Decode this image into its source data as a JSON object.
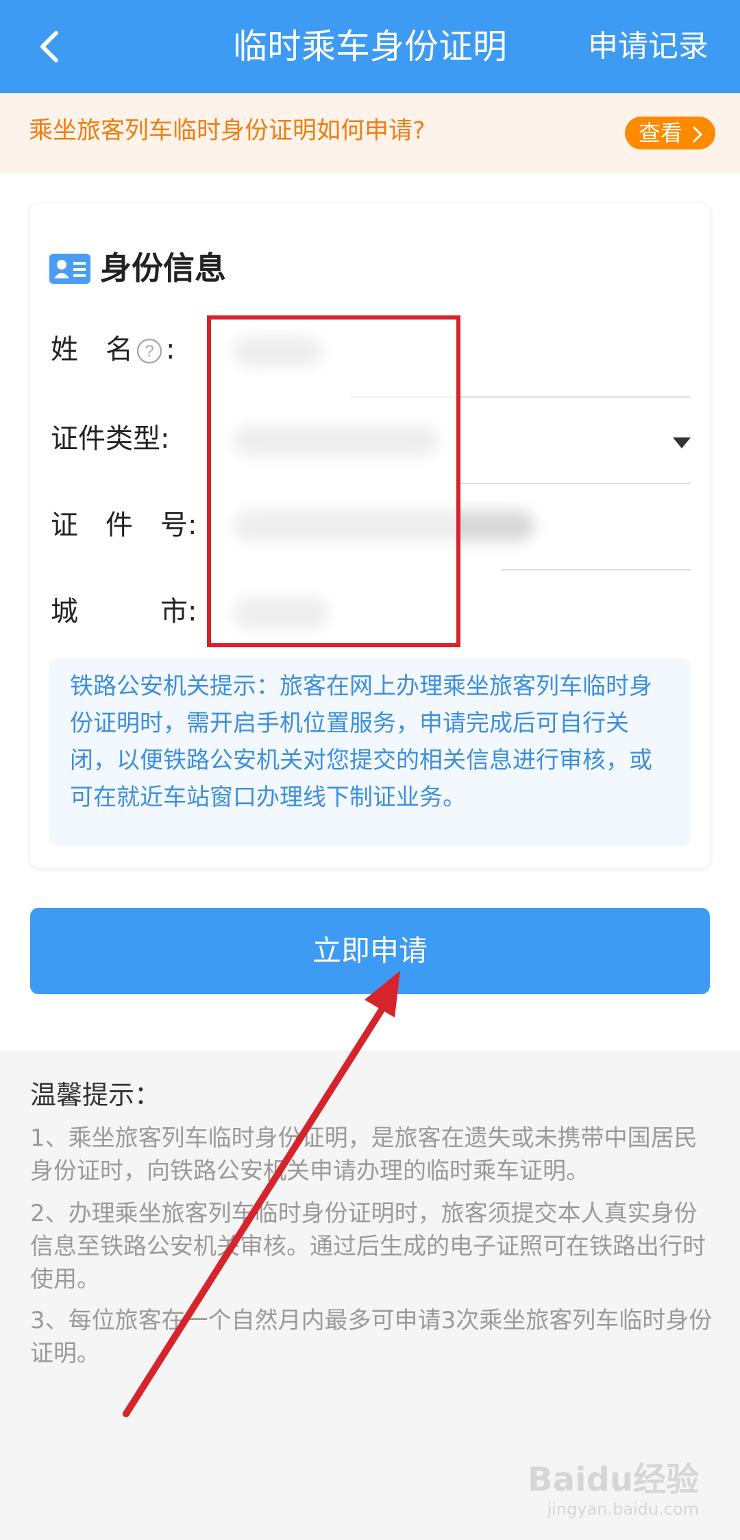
{
  "header": {
    "title": "临时乘车身份证明",
    "record_label": "申请记录"
  },
  "banner": {
    "text": "乘坐旅客列车临时身份证明如何申请?",
    "button": "查看"
  },
  "card": {
    "title": "身份信息",
    "fields": [
      {
        "label": "姓　名",
        "suffix": ":"
      },
      {
        "label": "证件类型:"
      },
      {
        "label": "证　件　号:"
      },
      {
        "label": "城　　　市:"
      }
    ],
    "notice": "铁路公安机关提示：旅客在网上办理乘坐旅客列车临时身份证明时，需开启手机位置服务，申请完成后可自行关闭，以便铁路公安机关对您提交的相关信息进行审核，或可在就近车站窗口办理线下制证业务。"
  },
  "apply_button": "立即申请",
  "tips": {
    "title": "温馨提示：",
    "items": [
      "1、乘坐旅客列车临时身份证明，是旅客在遗失或未携带中国居民身份证时，向铁路公安机关申请办理的临时乘车证明。",
      "2、办理乘坐旅客列车临时身份证明时，旅客须提交本人真实身份信息至铁路公安机关审核。通过后生成的电子证照可在铁路出行时使用。",
      "3、每位旅客在一个自然月内最多可申请3次乘坐旅客列车临时身份证明。"
    ]
  },
  "watermark": {
    "logo": "Baidu经验",
    "url": "jingyan.baidu.com"
  }
}
